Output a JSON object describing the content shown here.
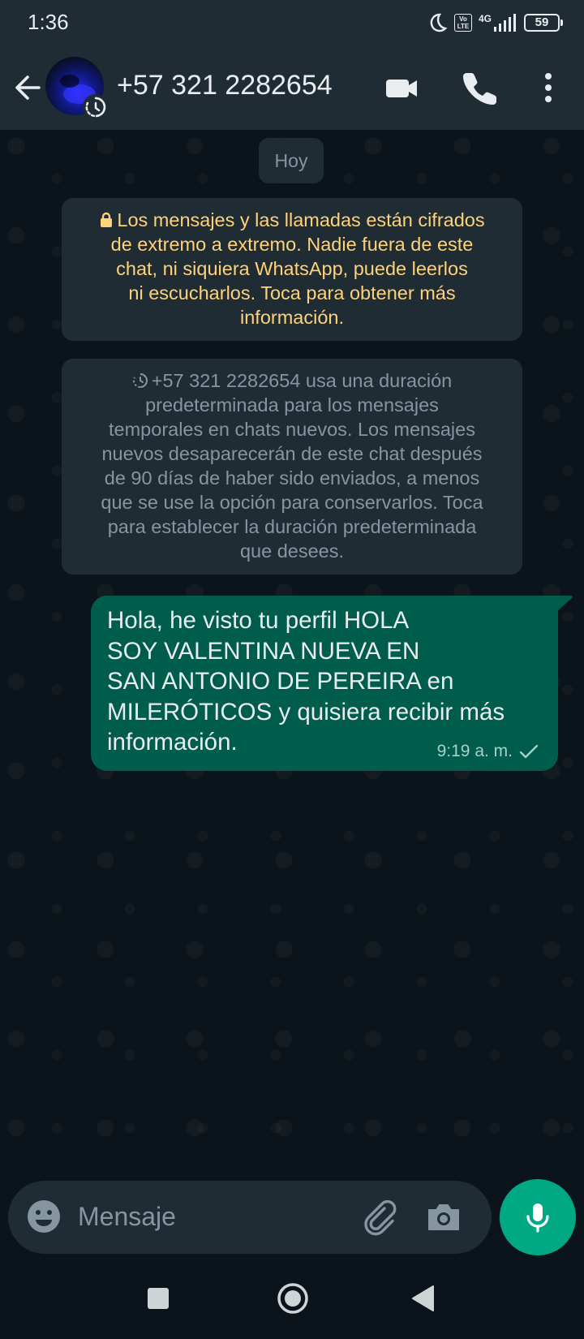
{
  "status_bar": {
    "time": "1:36",
    "volte_label": "Vo LTE",
    "network": "4G",
    "battery": "59"
  },
  "header": {
    "contact": "+57 321 2282654",
    "icons": [
      "back-arrow-icon",
      "video-call-icon",
      "voice-call-icon",
      "more-options-icon"
    ]
  },
  "chat": {
    "date_chip": "Hoy",
    "encryption_notice": {
      "lines": [
        "Los mensajes y las llamadas están cifrados",
        "de extremo a extremo. Nadie fuera de este",
        "chat, ni siquiera WhatsApp, puede leerlos",
        "ni escucharlos. Toca para obtener más",
        "información."
      ]
    },
    "ephemeral_notice": {
      "lines": [
        "+57 321 2282654 usa una duración",
        "predeterminada para los mensajes",
        "temporales en chats nuevos. Los mensajes",
        "nuevos desaparecerán de este chat después",
        "de 90 días de haber sido enviados, a menos",
        "que se use la opción para conservarlos. Toca",
        "para establecer la duración predeterminada",
        "que desees."
      ]
    },
    "message": {
      "lines": [
        "Hola, he visto tu perfil HOLA",
        "SOY VALENTINA NUEVA EN",
        "SAN ANTONIO DE PEREIRA en",
        "MILERÓTICOS y quisiera recibir más",
        "información."
      ],
      "time": "9:19 a. m.",
      "status": "sent"
    }
  },
  "composer": {
    "placeholder": "Mensaje"
  },
  "colors": {
    "header_bg": "#1f2c34",
    "chat_bg": "#0b141a",
    "outgoing_bubble": "#005c4b",
    "accent": "#00a884",
    "encryption_text": "#ffd279",
    "secondary_text": "#8696a0"
  }
}
